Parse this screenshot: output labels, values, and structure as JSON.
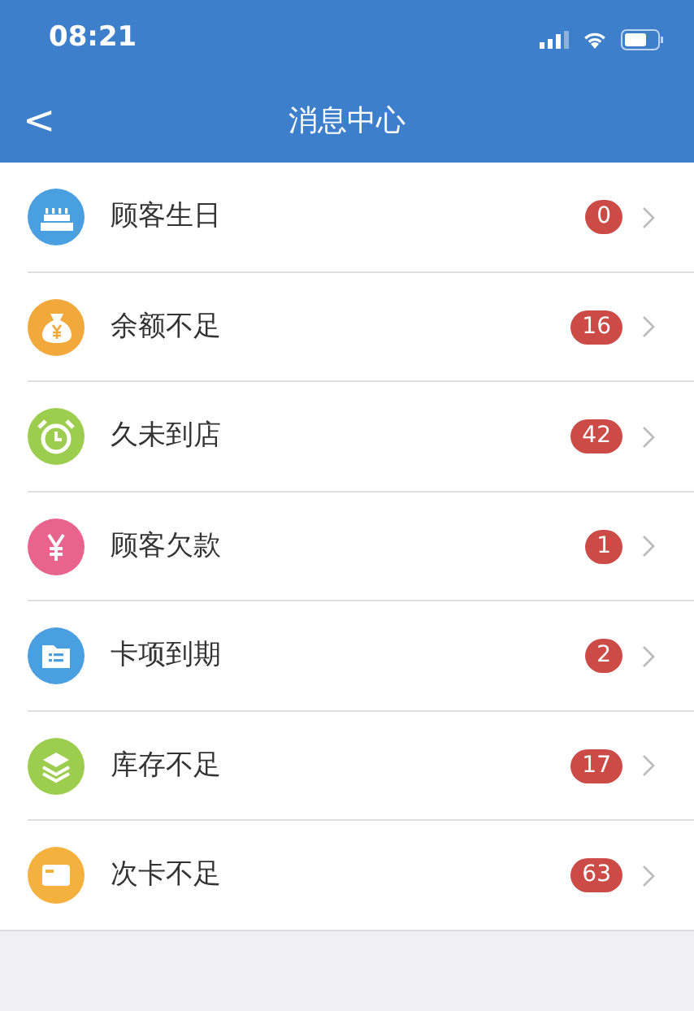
{
  "status_bar": {
    "time": "08:21"
  },
  "nav_bar": {
    "back": "<",
    "title": "消息中心"
  },
  "items": [
    {
      "kind": "cake",
      "color": "#4a9fe0",
      "label": "顾客生日",
      "count": "0"
    },
    {
      "kind": "moneybag",
      "color": "#f0a93a",
      "label": "余额不足",
      "count": "16"
    },
    {
      "kind": "clock",
      "color": "#9ccd4e",
      "label": "久未到店",
      "count": "42"
    },
    {
      "kind": "yen",
      "color": "#e8638e",
      "label": "顾客欠款",
      "count": "1"
    },
    {
      "kind": "folder",
      "color": "#4a9fe0",
      "label": "卡项到期",
      "count": "2"
    },
    {
      "kind": "layers",
      "color": "#9ccd4e",
      "label": "库存不足",
      "count": "17"
    },
    {
      "kind": "card",
      "color": "#f4b13e",
      "label": "次卡不足",
      "count": "63"
    }
  ]
}
